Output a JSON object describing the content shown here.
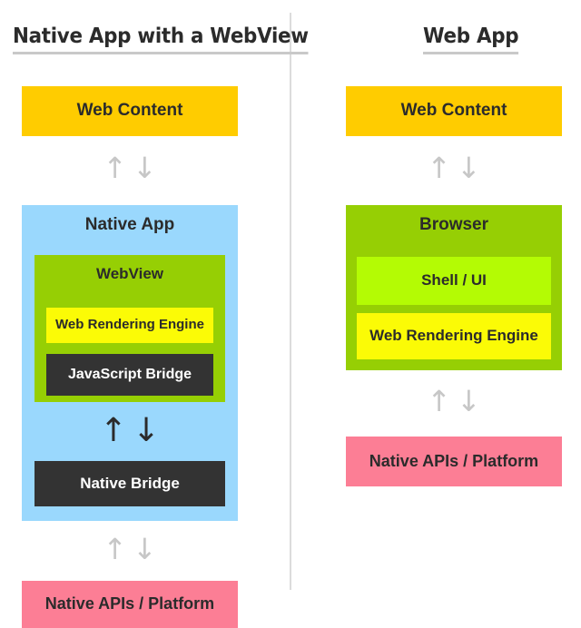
{
  "diagram": {
    "title_left": "Native App with a WebView",
    "title_right": "Web App",
    "colors": {
      "web_content": "#ffcc00",
      "native_app": "#9ad8fd",
      "webview": "#96cf04",
      "rendering_engine": "#fbfb06",
      "bridge": "#333333",
      "native_platform": "#fc7e95",
      "shell_ui": "#b4fb04",
      "arrow_grey": "#c7c7c7",
      "arrow_black": "#2b2b2b",
      "divider": "#dcdcdc"
    },
    "arrow_up": "↑",
    "arrow_down": "↓"
  },
  "left_column": {
    "title": "Native App with a WebView",
    "web_content": "Web Content",
    "native_app": "Native App",
    "webview": "WebView",
    "rendering_engine": "Web Rendering Engine",
    "javascript_bridge": "JavaScript Bridge",
    "native_bridge": "Native Bridge",
    "native_platform": "Native APIs / Platform"
  },
  "right_column": {
    "title": "Web App",
    "web_content": "Web Content",
    "browser": "Browser",
    "shell_ui": "Shell / UI",
    "rendering_engine": "Web Rendering Engine",
    "native_platform": "Native APIs / Platform"
  }
}
